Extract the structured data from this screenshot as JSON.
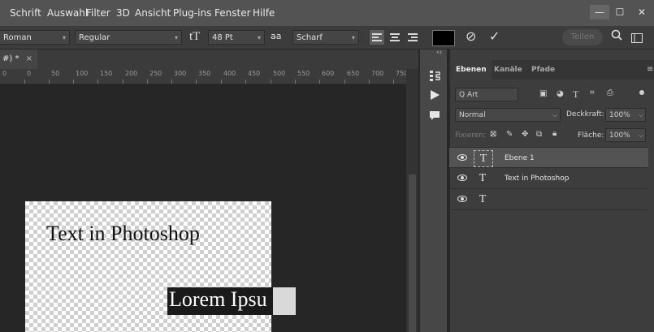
{
  "menubar": {
    "items": [
      "Schrift",
      "Auswahl",
      "Filter",
      "3D",
      "Ansicht",
      "Plug-ins",
      "Fenster",
      "Hilfe"
    ],
    "min": "—",
    "max": "☐",
    "close": "✕"
  },
  "options": {
    "font_family": "Roman",
    "font_style": "Regular",
    "font_size_icon": "tT",
    "font_size": "48 Pt",
    "aa_icon": "aa",
    "antialias": "Scharf",
    "cancel_icon": "⊘",
    "commit_icon": "✓",
    "share": "Teilen",
    "search_icon": "🔍",
    "workspace_icon": "▭"
  },
  "document": {
    "tab_title": "#) *",
    "tab_close": "×",
    "ruler_ticks": [
      "0",
      "0",
      "50",
      "100",
      "150",
      "200",
      "250",
      "300",
      "350",
      "400",
      "450",
      "500",
      "550",
      "600",
      "650",
      "700",
      "750"
    ],
    "text_layer_1": "Text in Photoshop",
    "text_layer_2": "Lorem Ipsu"
  },
  "dock": {
    "collapse": "‹‹",
    "icons": [
      "history-icon",
      "actions-play-icon",
      "comments-icon"
    ]
  },
  "layers_panel": {
    "tabs": [
      "Ebenen",
      "Kanäle",
      "Pfade"
    ],
    "menu_icon": "≡",
    "filter_placeholder": "Q Art",
    "blend_mode": "Normal",
    "opacity_label": "Deckkraft:",
    "opacity_value": "100%",
    "lock_label": "Fixieren:",
    "fill_label": "Fläche:",
    "fill_value": "100%",
    "layers": [
      {
        "name": "Ebene 1",
        "thumb": "T",
        "selected": true
      },
      {
        "name": "Text in Photoshop",
        "thumb": "T",
        "selected": false
      },
      {
        "name": "",
        "thumb": "T",
        "selected": false
      }
    ]
  }
}
